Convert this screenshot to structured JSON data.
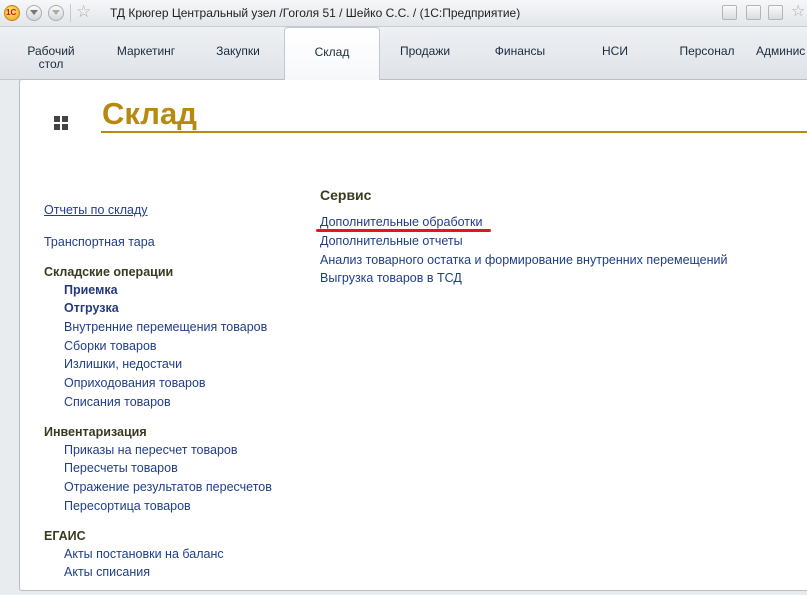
{
  "window": {
    "title": "ТД Крюгер Центральный узел /Гоголя 51 / Шейко С.С. /  (1С:Предприятие)"
  },
  "tabs": [
    {
      "label": "Рабочий стол",
      "active": false
    },
    {
      "label": "Маркетинг",
      "active": false
    },
    {
      "label": "Закупки",
      "active": false
    },
    {
      "label": "Склад",
      "active": true
    },
    {
      "label": "Продажи",
      "active": false
    },
    {
      "label": "Финансы",
      "active": false
    },
    {
      "label": "НСИ",
      "active": false
    },
    {
      "label": "Персонал",
      "active": false
    },
    {
      "label": "Админис",
      "active": false
    }
  ],
  "page": {
    "title": "Склад",
    "title_color": "#b8890f"
  },
  "left": {
    "reports_link": "Отчеты по складу",
    "transport_link": "Транспортная тара",
    "ops": {
      "heading": "Складские операции",
      "items": [
        "Приемка",
        "Отгрузка",
        "Внутренние перемещения товаров",
        "Сборки товаров",
        "Излишки, недостачи",
        "Оприходования товаров",
        "Списания товаров"
      ]
    },
    "inv": {
      "heading": "Инвентаризация",
      "items": [
        "Приказы на пересчет товаров",
        "Пересчеты товаров",
        "Отражение результатов пересчетов",
        "Пересортица товаров"
      ]
    },
    "egais": {
      "heading": "ЕГАИС",
      "items": [
        "Акты постановки на баланс",
        "Акты списания"
      ]
    }
  },
  "service": {
    "heading": "Сервис",
    "items": [
      "Дополнительные обработки",
      "Дополнительные отчеты",
      "Анализ товарного остатка и формирование внутренних перемещений",
      "Выгрузка товаров в ТСД"
    ]
  },
  "colors": {
    "link": "#1f3d8a",
    "highlight_underline": "#e01620"
  }
}
